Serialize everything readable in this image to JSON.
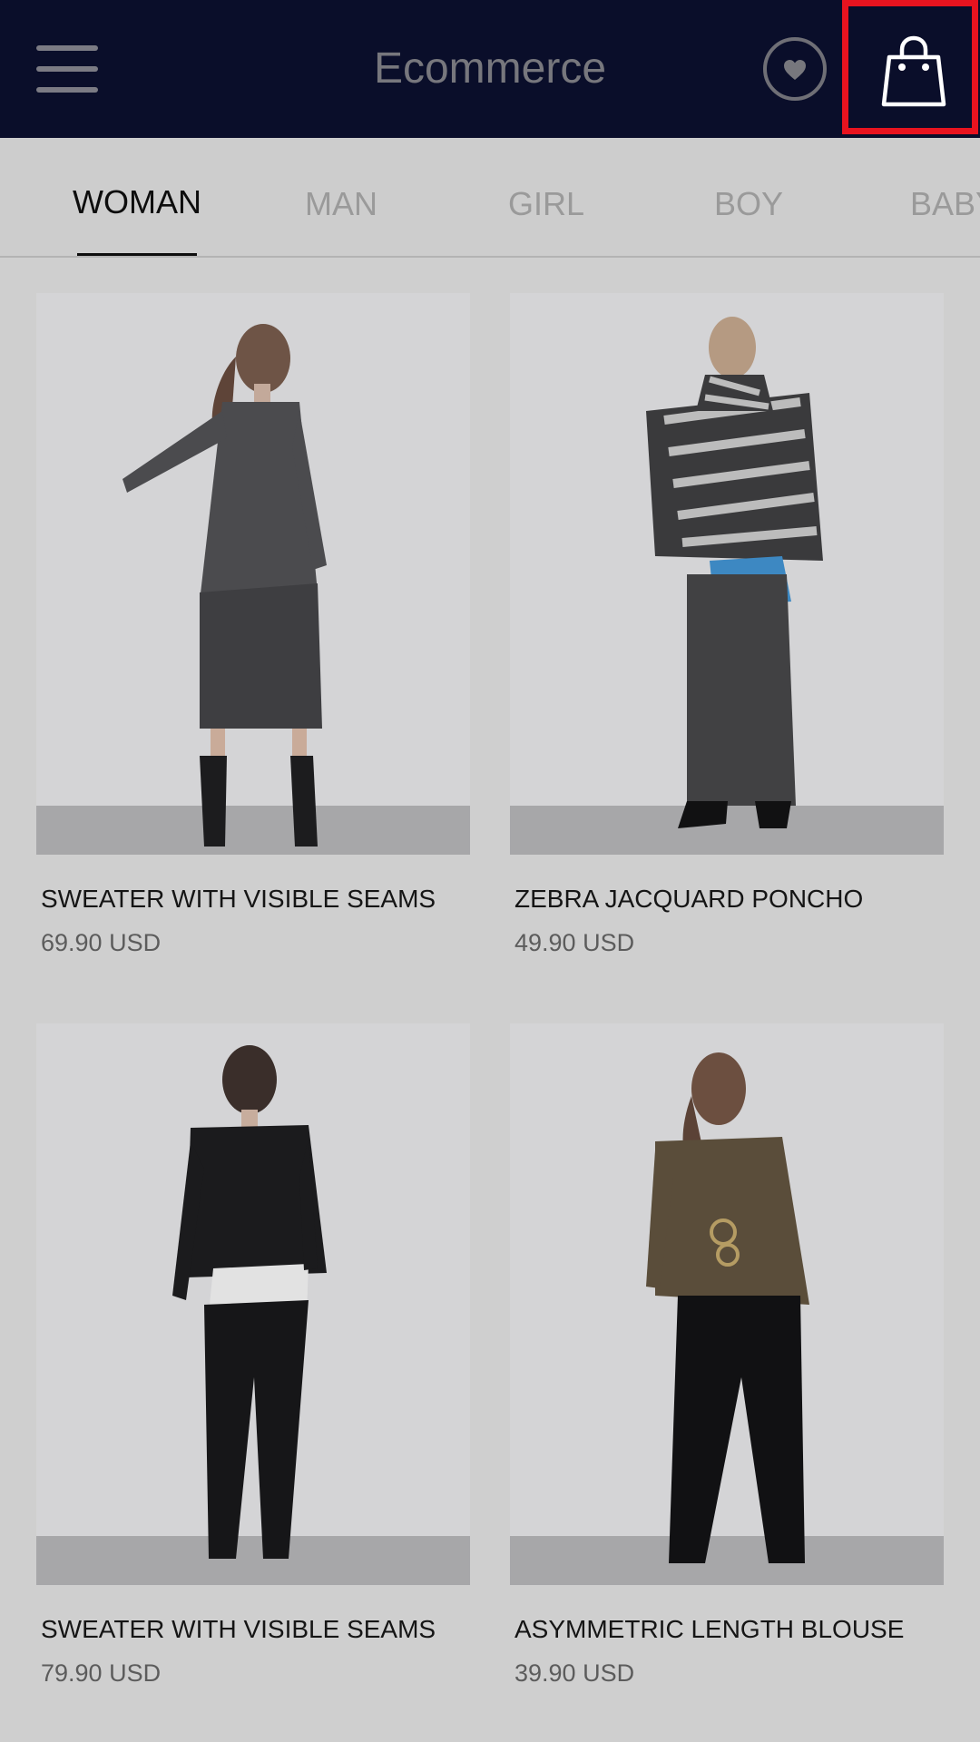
{
  "header": {
    "title": "Ecommerce",
    "menu_icon": "hamburger-menu-icon",
    "favorites_icon": "heart-icon",
    "cart_icon": "shopping-bag-icon",
    "background_color": "#0a0e2a",
    "highlight_color": "#e8131f"
  },
  "tabs": [
    {
      "label": "WOMAN",
      "active": true
    },
    {
      "label": "MAN",
      "active": false
    },
    {
      "label": "GIRL",
      "active": false
    },
    {
      "label": "BOY",
      "active": false
    },
    {
      "label": "BABY",
      "active": false
    }
  ],
  "products": [
    {
      "name": "SWEATER WITH VISIBLE SEAMS",
      "price": "69.90 USD"
    },
    {
      "name": "ZEBRA JACQUARD PONCHO",
      "price": "49.90 USD"
    },
    {
      "name": "SWEATER WITH VISIBLE SEAMS",
      "price": "79.90 USD"
    },
    {
      "name": "ASYMMETRIC LENGTH BLOUSE",
      "price": "39.90 USD"
    }
  ]
}
